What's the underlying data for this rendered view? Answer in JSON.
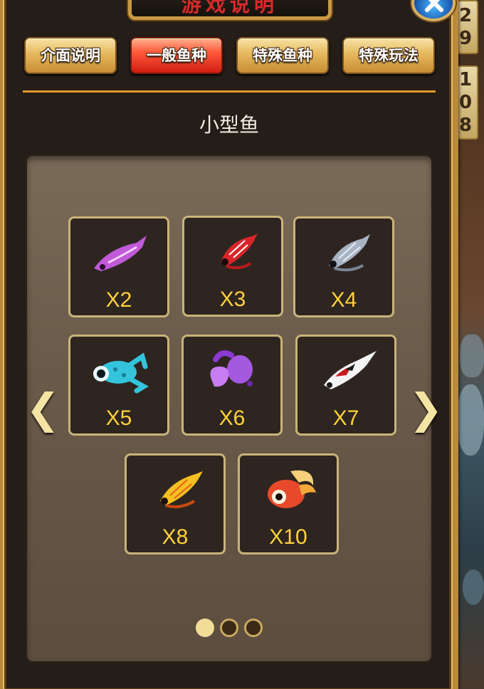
{
  "header": {
    "title": "游戏说明"
  },
  "tabs": [
    {
      "label": "介面说明",
      "active": false
    },
    {
      "label": "一般鱼种",
      "active": true
    },
    {
      "label": "特殊鱼种",
      "active": false
    },
    {
      "label": "特殊玩法",
      "active": false
    }
  ],
  "section": {
    "title": "小型鱼"
  },
  "fish": [
    {
      "multiplier": "X2",
      "icon": "purple-fish-icon",
      "color": "#c05ad8"
    },
    {
      "multiplier": "X3",
      "icon": "red-shrimp-icon",
      "color": "#d8262a"
    },
    {
      "multiplier": "X4",
      "icon": "grey-shrimp-icon",
      "color": "#a8b4c4"
    },
    {
      "multiplier": "X5",
      "icon": "blue-frog-icon",
      "color": "#33c4dc"
    },
    {
      "multiplier": "X6",
      "icon": "purple-crab-icon",
      "color": "#a558e0"
    },
    {
      "multiplier": "X7",
      "icon": "koi-fish-icon",
      "color": "#f4f4f4"
    },
    {
      "multiplier": "X8",
      "icon": "yellow-shrimp-icon",
      "color": "#f4c022"
    },
    {
      "multiplier": "X10",
      "icon": "goldfish-icon",
      "color": "#e8492a"
    }
  ],
  "pagination": {
    "pages": 3,
    "current": 1
  },
  "side_scores": {
    "strip_a": [
      "2",
      "9"
    ],
    "strip_b": [
      "1",
      "0",
      "8"
    ]
  },
  "colors": {
    "accent": "#e29a2a",
    "multiplier": "#ffd23a",
    "card_border": "#c8b47a"
  }
}
